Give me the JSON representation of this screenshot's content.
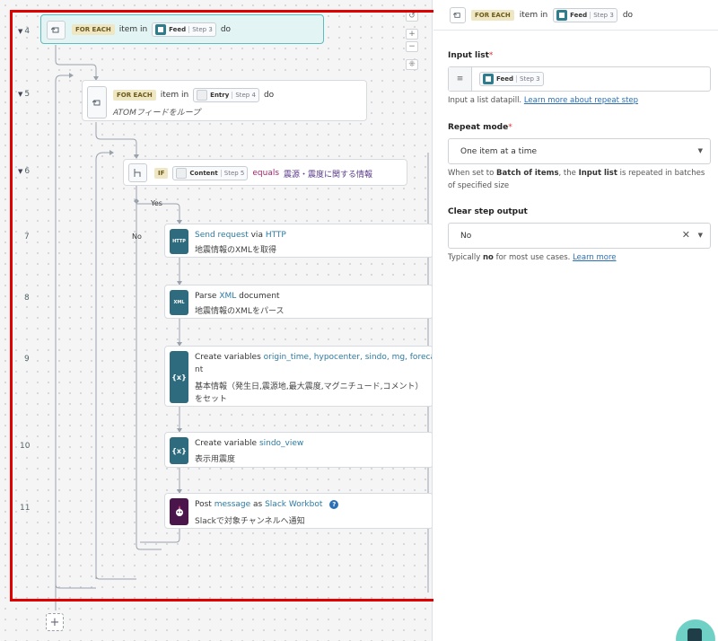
{
  "tab_hint": "",
  "flow": {
    "steps": [
      {
        "num": "4",
        "tag": "FOR EACH",
        "text_mid": "item in",
        "pill_name": "Feed",
        "pill_step": "Step 3",
        "text_end": "do"
      },
      {
        "num": "5",
        "tag": "FOR EACH",
        "text_mid": "item in",
        "pill_name": "Entry",
        "pill_step": "Step 4",
        "text_end": "do",
        "subtitle": "ATOMフィードをループ"
      },
      {
        "num": "6",
        "tag": "IF",
        "pill_name": "Content",
        "pill_step": "Step 5",
        "op": "equals",
        "value": "震源・震度に関する情報"
      },
      {
        "num": "7",
        "icon_label": "HTTP",
        "t1": "Send request",
        "t2": " via ",
        "t3": "HTTP",
        "subtitle": "地震情報のXMLを取得"
      },
      {
        "num": "8",
        "icon_label": "XML",
        "t1": "Parse ",
        "t2": "XML",
        "t3": " document",
        "subtitle": "地震情報のXMLをパース"
      },
      {
        "num": "9",
        "icon_label": "{x}",
        "t1": "Create variables ",
        "vars": "origin_time, hypocenter, sindo, mg, forecast_comme",
        "vars2": "nt",
        "subtitle": "基本情報（発生日,震源地,最大震度,マグニチュード,コメント）",
        "subtitle2": "をセット"
      },
      {
        "num": "10",
        "icon_label": "{x}",
        "t1": "Create variable ",
        "vars": "sindo_view",
        "subtitle": "表示用震度"
      },
      {
        "num": "11",
        "icon_label": "slack",
        "t1": "Post ",
        "t2": "message",
        "t3": " as ",
        "t4": "Slack Workbot",
        "subtitle": "Slackで対象チャンネルへ通知"
      }
    ],
    "branch_yes": "Yes",
    "branch_no": "No",
    "add_step": "+"
  },
  "panel": {
    "header": {
      "tag": "FOR EACH",
      "text_mid": "item in",
      "pill_name": "Feed",
      "pill_step": "Step 3",
      "text_end": "do"
    },
    "input_list": {
      "label": "Input list",
      "required": "*",
      "pill_name": "Feed",
      "pill_step": "Step 3",
      "help": "Input a list datapill.",
      "help_link": "Learn more about repeat step"
    },
    "repeat_mode": {
      "label": "Repeat mode",
      "required": "*",
      "value": "One item at a time",
      "help_pre": "When set to ",
      "help_b1": "Batch of items",
      "help_mid": ", the ",
      "help_b2": "Input list",
      "help_post": " is repeated in batches of specified size"
    },
    "clear_output": {
      "label": "Clear step output",
      "value": "No",
      "help_pre": "Typically ",
      "help_b": "no",
      "help_post": " for most use cases.",
      "help_link": "Learn more"
    }
  },
  "colors": {
    "highlight_frame": "#e00000",
    "selected_card": "#e3f4f4",
    "accent_teal": "#2e6b7e"
  }
}
